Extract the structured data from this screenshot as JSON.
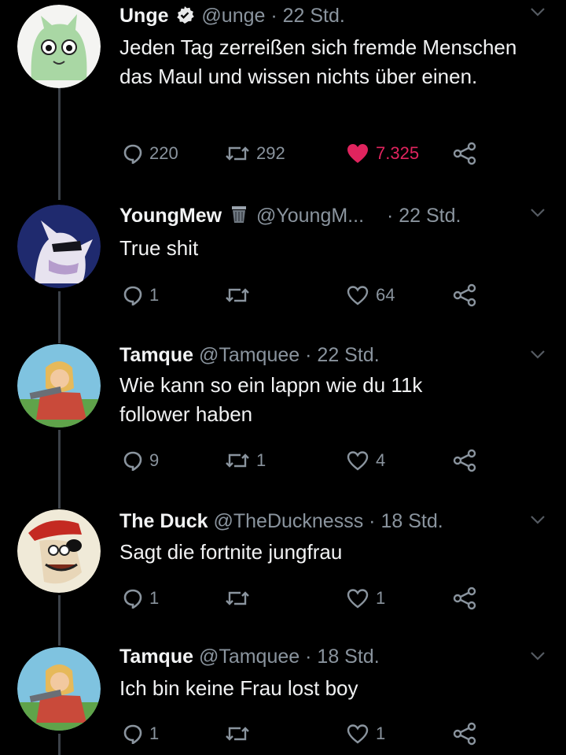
{
  "tweets": [
    {
      "name": "Unge",
      "handle": "@unge",
      "time": "· 22 Std.",
      "text": "Jeden Tag zerreißen sich fremde Menschen das Maul und wissen nichts über einen.",
      "replies": "220",
      "retweets": "292",
      "likes": "7.325",
      "liked": true,
      "badge": "verified-icon"
    },
    {
      "name": "YoungMew",
      "handle": "@YoungM...",
      "time": "· 22 Std.",
      "text": "True shit",
      "replies": "1",
      "retweets": "",
      "likes": "64",
      "badge": "trash-icon"
    },
    {
      "name": "Tamque",
      "handle": "@Tamquee",
      "time": "· 22 Std.",
      "text": "Wie kann so ein lappn wie du 11k follower haben",
      "replies": "9",
      "retweets": "1",
      "likes": "4"
    },
    {
      "name": "The Duck",
      "handle": "@TheDucknesss",
      "time": "· 18 Std.",
      "text": "Sagt die fortnite jungfrau",
      "replies": "1",
      "retweets": "",
      "likes": "1"
    },
    {
      "name": "Tamque",
      "handle": "@Tamquee",
      "time": "· 18 Std.",
      "text": "Ich bin keine Frau lost boy",
      "replies": "1",
      "retweets": "",
      "likes": "1"
    }
  ],
  "colors": {
    "background": "#000000",
    "like_active": "#e0245e",
    "muted": "#8a949e",
    "thread_line": "#3c4249"
  }
}
